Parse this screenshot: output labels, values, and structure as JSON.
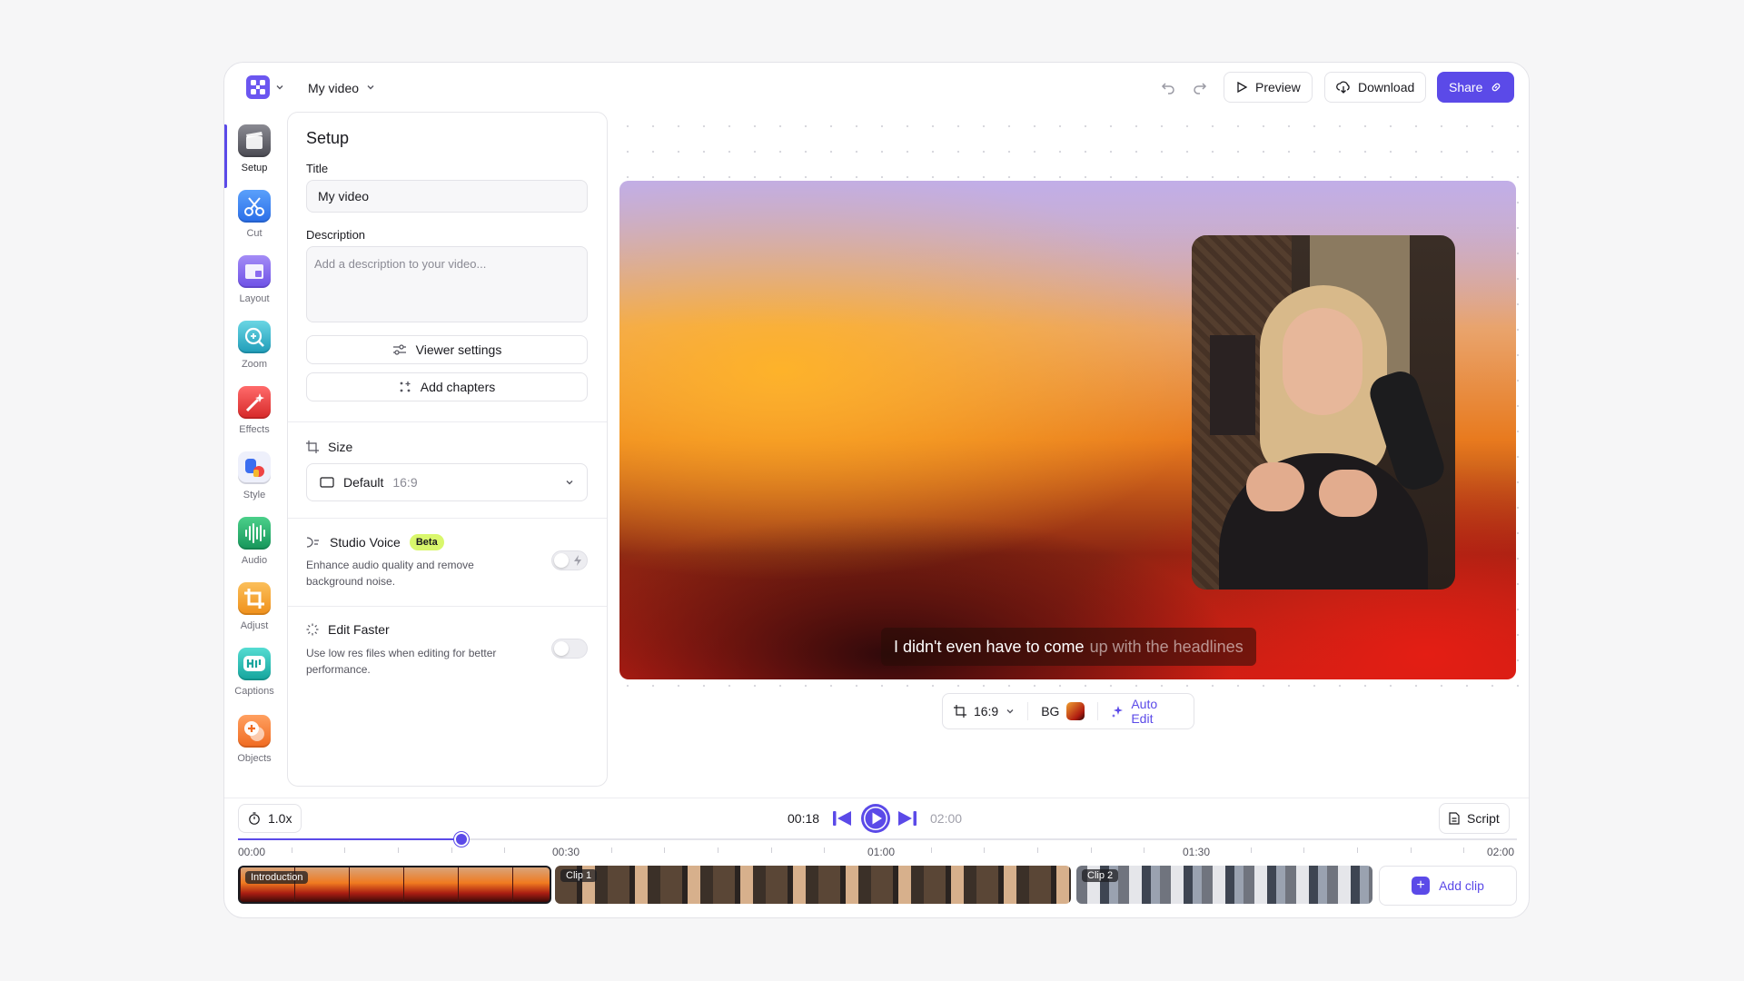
{
  "header": {
    "doc_title": "My video",
    "preview_label": "Preview",
    "download_label": "Download",
    "share_label": "Share"
  },
  "rail": [
    {
      "label": "Setup",
      "icon": "clapperboard-icon",
      "color": "#5a5a62"
    },
    {
      "label": "Cut",
      "icon": "scissors-icon",
      "color": "#3b82f6"
    },
    {
      "label": "Layout",
      "icon": "layout-icon",
      "color": "#8b6cf0"
    },
    {
      "label": "Zoom",
      "icon": "magnifier-icon",
      "color": "#2bb0c8"
    },
    {
      "label": "Effects",
      "icon": "magic-wand-icon",
      "color": "#ef4444"
    },
    {
      "label": "Style",
      "icon": "shapes-icon",
      "color": "#3b6ef0"
    },
    {
      "label": "Audio",
      "icon": "waveform-icon",
      "color": "#22b36b"
    },
    {
      "label": "Adjust",
      "icon": "crop-icon",
      "color": "#f59e2b"
    },
    {
      "label": "Captions",
      "icon": "captions-icon",
      "color": "#1fb8b0"
    },
    {
      "label": "Objects",
      "icon": "objects-icon",
      "color": "#f77d2e"
    }
  ],
  "setup": {
    "heading": "Setup",
    "title_label": "Title",
    "title_value": "My video",
    "description_label": "Description",
    "description_placeholder": "Add a description to your video...",
    "viewer_settings_label": "Viewer settings",
    "add_chapters_label": "Add chapters",
    "size_label": "Size",
    "size_value": "Default",
    "size_ratio": "16:9",
    "studio_voice_label": "Studio Voice",
    "studio_voice_badge": "Beta",
    "studio_voice_desc": "Enhance audio quality and remove background noise.",
    "studio_voice_enabled": false,
    "edit_faster_label": "Edit Faster",
    "edit_faster_desc": "Use low res files when editing for better performance.",
    "edit_faster_enabled": false
  },
  "preview": {
    "caption_spoken": "I didn't even have to come",
    "caption_upcoming": "up with the headlines"
  },
  "video_toolbar": {
    "aspect_ratio": "16:9",
    "bg_label": "BG",
    "auto_edit_label": "Auto Edit"
  },
  "timeline": {
    "speed": "1.0x",
    "current_time": "00:18",
    "total_time": "02:00",
    "progress": 0.175,
    "script_label": "Script",
    "time_labels": [
      "00:00",
      "00:30",
      "01:00",
      "01:30",
      "02:00"
    ],
    "clips": [
      "Introduction",
      "Clip 1",
      "Clip 2"
    ],
    "add_clip_label": "Add clip"
  },
  "colors": {
    "accent": "#5b4ae8",
    "beta_badge": "#d9f76c"
  }
}
